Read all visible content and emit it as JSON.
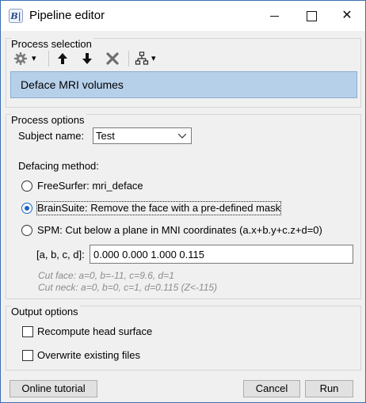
{
  "window": {
    "app_icon_text": "B|",
    "title": "Pipeline editor",
    "minimize_icon": "minimize-icon",
    "maximize_icon": "maximize-icon",
    "close_icon": "close-icon",
    "close_glyph": "✕"
  },
  "process_selection": {
    "title": "Process selection",
    "toolbar": {
      "gear_icon": "gear-icon",
      "gear_dropdown": "▾",
      "move_up_icon": "arrow-up-icon",
      "move_up_glyph": "🡅",
      "move_down_icon": "arrow-down-icon",
      "move_down_glyph": "🡇",
      "delete_icon": "delete-x-icon",
      "delete_glyph": "✖",
      "pipeline_icon": "tree-icon",
      "pipeline_dropdown": "▾"
    },
    "selected_process": "Deface MRI volumes"
  },
  "process_options": {
    "title": "Process options",
    "subject_label": "Subject name:",
    "subject_value": "Test",
    "defacing_label": "Defacing method:",
    "methods": [
      {
        "label": "FreeSurfer: mri_deface",
        "checked": false
      },
      {
        "label": "BrainSuite: Remove the face with a pre-defined mask",
        "checked": true
      },
      {
        "label": "SPM: Cut below a plane in MNI coordinates (a.x+b.y+c.z+d=0)",
        "checked": false
      }
    ],
    "abcd_label": "[a, b, c, d]:",
    "abcd_value": "0.000 0.000 1.000 0.115",
    "hint_face": "Cut face: a=0, b=-11, c=9.6, d=1",
    "hint_neck": "Cut neck: a=0, b=0, c=1, d=0.115 (Z<-115)"
  },
  "output_options": {
    "title": "Output options",
    "recompute_label": "Recompute head surface",
    "recompute_checked": false,
    "overwrite_label": "Overwrite existing files",
    "overwrite_checked": false
  },
  "buttons": {
    "tutorial": "Online tutorial",
    "cancel": "Cancel",
    "run": "Run"
  },
  "colors": {
    "selection_bg": "#b7d0ea",
    "radio_checked": "#1a64c8",
    "window_border": "#3a6fb0"
  }
}
